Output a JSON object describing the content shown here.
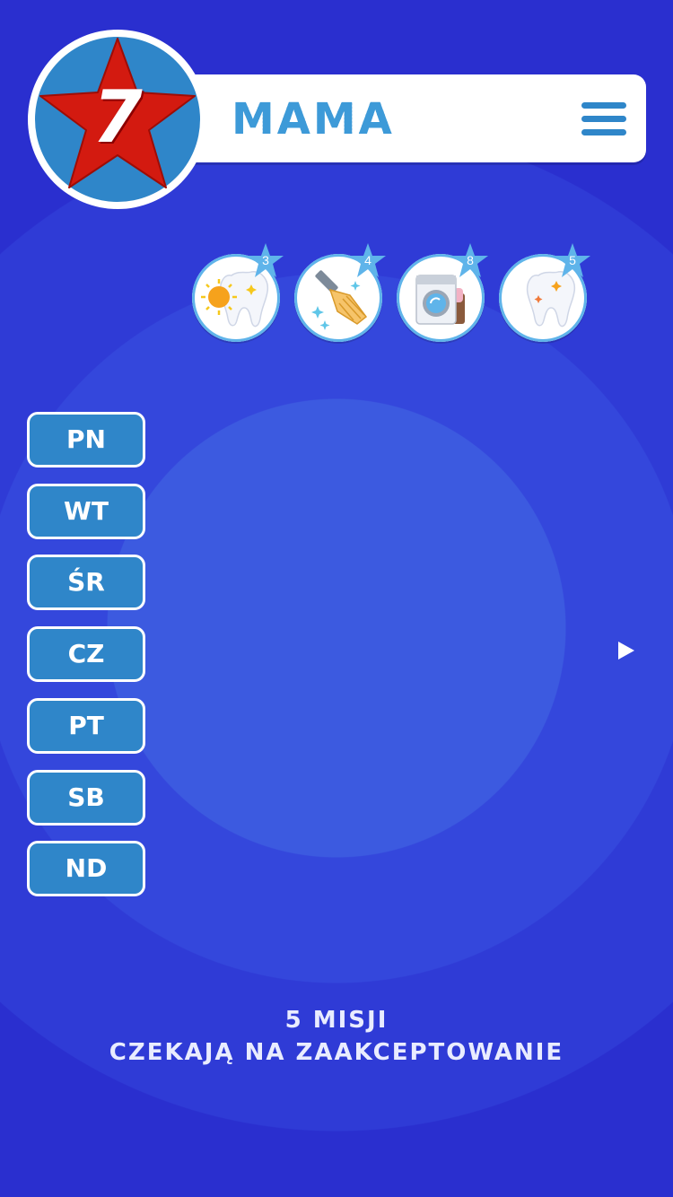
{
  "header": {
    "level_badge": "7",
    "title": "MAMA",
    "menu_icon": "hamburger-menu-icon"
  },
  "missions": [
    {
      "name": "tooth-morning-icon",
      "count": "3"
    },
    {
      "name": "sweeping-brush-icon",
      "count": "4"
    },
    {
      "name": "washing-machine-icon",
      "count": "8"
    },
    {
      "name": "tooth-night-icon",
      "count": "5"
    }
  ],
  "days": [
    {
      "label": "PN",
      "status": [
        "red",
        "yellow",
        "green",
        "green"
      ]
    },
    {
      "label": "WT",
      "status": [
        "green",
        "yellow",
        "yellow",
        "red"
      ]
    },
    {
      "label": "ŚR",
      "status": [
        "red",
        "red",
        "green",
        "green"
      ]
    },
    {
      "label": "CZ",
      "status": [
        "red",
        "yellow",
        "yellow",
        "green"
      ]
    },
    {
      "label": "PT",
      "status": [
        "green",
        "green",
        "red",
        "red"
      ]
    },
    {
      "label": "SB",
      "status": [
        "white",
        "white",
        "white",
        "white"
      ]
    },
    {
      "label": "ND",
      "status": [
        "white",
        "white",
        "white",
        "white"
      ]
    }
  ],
  "current_day_marker": "play-arrow-icon",
  "footer": {
    "line1": "5 MISJI",
    "line2": "CZEKAJĄ NA ZAAKCEPTOWANIE"
  },
  "colors": {
    "background": "#2a2fcf",
    "accent": "#2f86c9",
    "red": "#d6271a",
    "yellow": "#f6c81c",
    "green": "#1fb432",
    "white": "#f2f2f2"
  }
}
